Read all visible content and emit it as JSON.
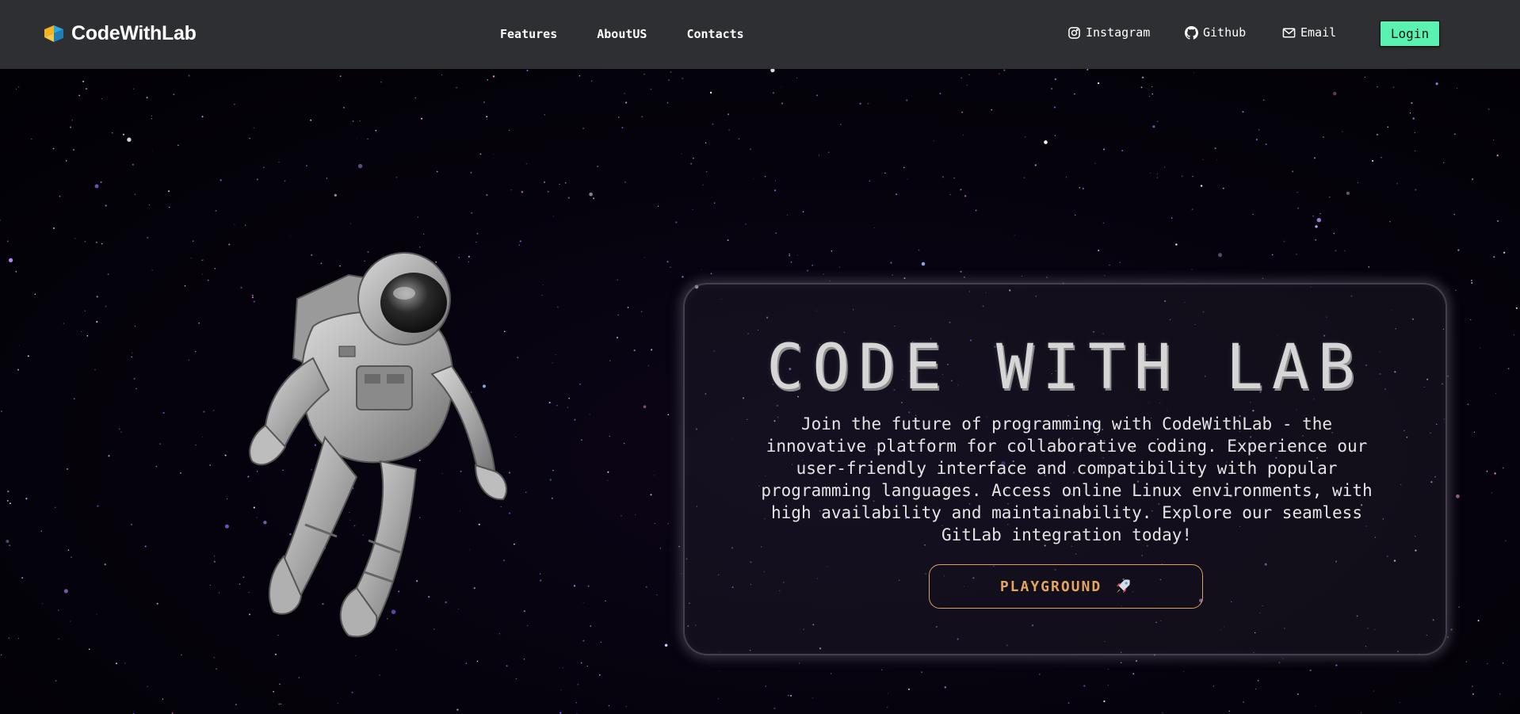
{
  "navbar": {
    "brand": {
      "name": "CodeWithLab",
      "logo_icon": "cube-logo-icon"
    },
    "links": [
      {
        "label": "Features"
      },
      {
        "label": "AboutUS"
      },
      {
        "label": "Contacts"
      }
    ],
    "socials": [
      {
        "label": "Instagram",
        "icon": "instagram-icon"
      },
      {
        "label": "Github",
        "icon": "github-icon"
      },
      {
        "label": "Email",
        "icon": "mail-icon"
      }
    ],
    "login_label": "Login"
  },
  "hero": {
    "title": "CODE WITH LAB",
    "description_lines": [
      "Join the future of programming with CodeWithLab - the",
      "innovative platform for collaborative coding. Experience our",
      "user-friendly interface and compatibility with popular",
      "programming languages. Access online Linux environments, with",
      "high availability and maintainability. Explore our seamless",
      "GitLab integration today!"
    ],
    "cta_label": "PLAYGROUND",
    "cta_icon": "rocket-icon"
  },
  "colors": {
    "navbar_bg": "#2e2f33",
    "login_bg": "#5af2b2",
    "cta_accent": "#e3a55c",
    "title": "#d6d6d6"
  }
}
